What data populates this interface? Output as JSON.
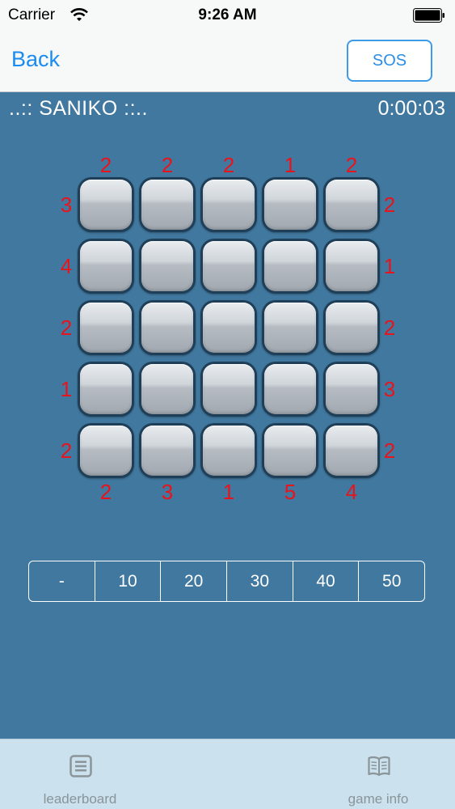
{
  "status": {
    "carrier": "Carrier",
    "time": "9:26 AM"
  },
  "nav": {
    "back_label": "Back",
    "sos_label": "SOS"
  },
  "game": {
    "title": "..:: SANIKO ::..",
    "timer": "0:00:03"
  },
  "clues": {
    "top": [
      "2",
      "2",
      "2",
      "1",
      "2"
    ],
    "bottom": [
      "2",
      "3",
      "1",
      "5",
      "4"
    ],
    "left": [
      "3",
      "4",
      "2",
      "1",
      "2"
    ],
    "right": [
      "2",
      "1",
      "2",
      "3",
      "2"
    ]
  },
  "grid": {
    "rows": 5,
    "cols": 5
  },
  "segments": [
    "-",
    "10",
    "20",
    "30",
    "40",
    "50"
  ],
  "tabs": [
    {
      "label": "leaderboard",
      "icon": "list-icon"
    },
    {
      "label": "game info",
      "icon": "book-icon"
    }
  ],
  "colors": {
    "background": "#41789f",
    "clue": "#e8141c",
    "accent": "#1a8cf0",
    "tab_bar": "#cbe2ee"
  }
}
